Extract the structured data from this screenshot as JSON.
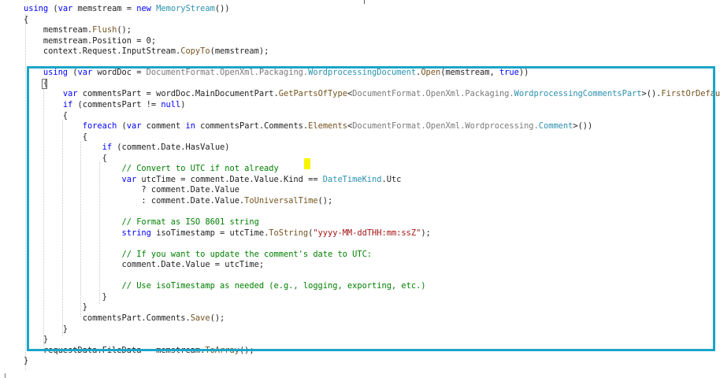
{
  "editor": {
    "lines": [
      {
        "tokens": [
          {
            "t": "using",
            "c": "kw"
          },
          {
            "t": " (",
            "c": "pl"
          },
          {
            "t": "var",
            "c": "kw"
          },
          {
            "t": " memstream = ",
            "c": "pl"
          },
          {
            "t": "new",
            "c": "kw"
          },
          {
            "t": " ",
            "c": "pl"
          },
          {
            "t": "MemoryStream",
            "c": "ty"
          },
          {
            "t": "())",
            "c": "pl"
          }
        ]
      },
      {
        "tokens": [
          {
            "t": "{",
            "c": "pl"
          }
        ]
      },
      {
        "tokens": [
          {
            "t": "    memstream.",
            "c": "pl"
          },
          {
            "t": "Flush",
            "c": "mt"
          },
          {
            "t": "();",
            "c": "pl"
          }
        ]
      },
      {
        "tokens": [
          {
            "t": "    memstream.Position = 0;",
            "c": "pl"
          }
        ]
      },
      {
        "tokens": [
          {
            "t": "    context.Request.InputStream.",
            "c": "pl"
          },
          {
            "t": "CopyTo",
            "c": "mt"
          },
          {
            "t": "(memstream);",
            "c": "pl"
          }
        ]
      },
      {
        "tokens": []
      },
      {
        "tokens": [
          {
            "t": "    ",
            "c": "pl"
          },
          {
            "t": "using",
            "c": "kw"
          },
          {
            "t": " (",
            "c": "pl"
          },
          {
            "t": "var",
            "c": "kw"
          },
          {
            "t": " wordDoc = ",
            "c": "pl"
          },
          {
            "t": "DocumentFormat.OpenXml.Packaging.",
            "c": "ns"
          },
          {
            "t": "WordprocessingDocument",
            "c": "ty"
          },
          {
            "t": ".",
            "c": "pl"
          },
          {
            "t": "Open",
            "c": "mt"
          },
          {
            "t": "(memstream, ",
            "c": "pl"
          },
          {
            "t": "true",
            "c": "kw"
          },
          {
            "t": "))",
            "c": "pl"
          }
        ]
      },
      {
        "tokens": [
          {
            "t": "    {",
            "c": "pl"
          }
        ]
      },
      {
        "tokens": [
          {
            "t": "        ",
            "c": "pl"
          },
          {
            "t": "var",
            "c": "kw"
          },
          {
            "t": " commentsPart = wordDoc.MainDocumentPart.",
            "c": "pl"
          },
          {
            "t": "GetPartsOfType",
            "c": "mt"
          },
          {
            "t": "<",
            "c": "pl"
          },
          {
            "t": "DocumentFormat.OpenXml.Packaging.",
            "c": "ns"
          },
          {
            "t": "WordprocessingCommentsPart",
            "c": "ty"
          },
          {
            "t": ">().",
            "c": "pl"
          },
          {
            "t": "FirstOrDefault",
            "c": "mt"
          },
          {
            "t": "();",
            "c": "pl"
          }
        ]
      },
      {
        "tokens": [
          {
            "t": "        ",
            "c": "pl"
          },
          {
            "t": "if",
            "c": "kw"
          },
          {
            "t": " (commentsPart != ",
            "c": "pl"
          },
          {
            "t": "null",
            "c": "kw"
          },
          {
            "t": ")",
            "c": "pl"
          }
        ]
      },
      {
        "tokens": [
          {
            "t": "        {",
            "c": "pl"
          }
        ]
      },
      {
        "tokens": [
          {
            "t": "            ",
            "c": "pl"
          },
          {
            "t": "foreach",
            "c": "kw"
          },
          {
            "t": " (",
            "c": "pl"
          },
          {
            "t": "var",
            "c": "kw"
          },
          {
            "t": " comment ",
            "c": "pl"
          },
          {
            "t": "in",
            "c": "kw"
          },
          {
            "t": " commentsPart.Comments.",
            "c": "pl"
          },
          {
            "t": "Elements",
            "c": "mt"
          },
          {
            "t": "<",
            "c": "pl"
          },
          {
            "t": "DocumentFormat.OpenXml.Wordprocessing.",
            "c": "ns"
          },
          {
            "t": "Comment",
            "c": "ty"
          },
          {
            "t": ">())",
            "c": "pl"
          }
        ]
      },
      {
        "tokens": [
          {
            "t": "            {",
            "c": "pl"
          }
        ]
      },
      {
        "tokens": [
          {
            "t": "                ",
            "c": "pl"
          },
          {
            "t": "if",
            "c": "kw"
          },
          {
            "t": " (comment.Date.HasValue)",
            "c": "pl"
          }
        ]
      },
      {
        "tokens": [
          {
            "t": "                {",
            "c": "pl"
          }
        ]
      },
      {
        "tokens": [
          {
            "t": "                    ",
            "c": "pl"
          },
          {
            "t": "// Convert to UTC if not already",
            "c": "cm"
          }
        ]
      },
      {
        "tokens": [
          {
            "t": "                    ",
            "c": "pl"
          },
          {
            "t": "var",
            "c": "kw"
          },
          {
            "t": " utcTime = comment.Date.Value.Kind == ",
            "c": "pl"
          },
          {
            "t": "DateTimeKind",
            "c": "ty"
          },
          {
            "t": ".Utc",
            "c": "pl"
          }
        ]
      },
      {
        "tokens": [
          {
            "t": "                        ? comment.Date.Value",
            "c": "pl"
          }
        ]
      },
      {
        "tokens": [
          {
            "t": "                        : comment.Date.Value.",
            "c": "pl"
          },
          {
            "t": "ToUniversalTime",
            "c": "mt"
          },
          {
            "t": "();",
            "c": "pl"
          }
        ]
      },
      {
        "tokens": []
      },
      {
        "tokens": [
          {
            "t": "                    ",
            "c": "pl"
          },
          {
            "t": "// Format as ISO 8601 string",
            "c": "cm"
          }
        ]
      },
      {
        "tokens": [
          {
            "t": "                    ",
            "c": "pl"
          },
          {
            "t": "string",
            "c": "kw"
          },
          {
            "t": " isoTimestamp = utcTime.",
            "c": "pl"
          },
          {
            "t": "ToString",
            "c": "mt"
          },
          {
            "t": "(",
            "c": "pl"
          },
          {
            "t": "\"yyyy-MM-ddTHH:mm:ssZ\"",
            "c": "st"
          },
          {
            "t": ");",
            "c": "pl"
          }
        ]
      },
      {
        "tokens": []
      },
      {
        "tokens": [
          {
            "t": "                    ",
            "c": "pl"
          },
          {
            "t": "// If you want to update the comment's date to UTC:",
            "c": "cm"
          }
        ]
      },
      {
        "tokens": [
          {
            "t": "                    comment.Date.Value = utcTime;",
            "c": "pl"
          }
        ]
      },
      {
        "tokens": []
      },
      {
        "tokens": [
          {
            "t": "                    ",
            "c": "pl"
          },
          {
            "t": "// Use isoTimestamp as needed (e.g., logging, exporting, etc.)",
            "c": "cm"
          }
        ]
      },
      {
        "tokens": [
          {
            "t": "                }",
            "c": "pl"
          }
        ]
      },
      {
        "tokens": [
          {
            "t": "            }",
            "c": "pl"
          }
        ]
      },
      {
        "tokens": [
          {
            "t": "            commentsPart.Comments.",
            "c": "pl"
          },
          {
            "t": "Save",
            "c": "mt"
          },
          {
            "t": "();",
            "c": "pl"
          }
        ]
      },
      {
        "tokens": [
          {
            "t": "        }",
            "c": "pl"
          }
        ]
      },
      {
        "tokens": [
          {
            "t": "    }",
            "c": "pl"
          }
        ]
      },
      {
        "tokens": [
          {
            "t": "    requestData.FileData = memstream.",
            "c": "pl"
          },
          {
            "t": "ToArray",
            "c": "mt"
          },
          {
            "t": "();",
            "c": "pl"
          }
        ]
      },
      {
        "tokens": [
          {
            "t": "}",
            "c": "pl"
          }
        ]
      }
    ]
  },
  "colors": {
    "keyword": "#0000ff",
    "type": "#2b91af",
    "method": "#74531f",
    "comment": "#008000",
    "string": "#a31515",
    "namespace": "#7a7a7a",
    "highlight_border": "#1aa6c9",
    "cursor_marker": "#f5f500"
  }
}
